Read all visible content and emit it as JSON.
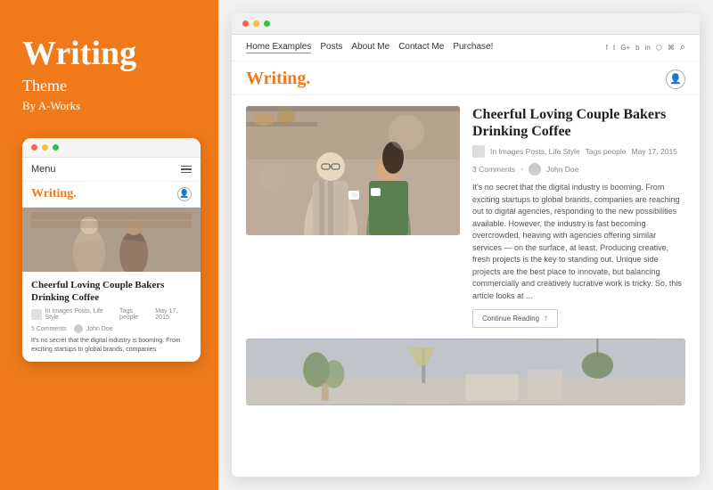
{
  "left": {
    "theme_title": "Writing",
    "theme_word": "Theme",
    "theme_by": "By A-Works",
    "mobile": {
      "nav_menu": "Menu",
      "logo": "Writing",
      "logo_dot": ".",
      "post_title": "Cheerful Loving Couple Bakers Drinking Coffee",
      "meta_category": "In Images Posts, Life Style",
      "meta_tags": "Tags people",
      "meta_date": "May 17, 2015",
      "meta_comments": "5 Comments",
      "meta_author": "John Doe",
      "excerpt": "It's no secret that the digital industry is booming. From exciting startups to global brands, companies"
    }
  },
  "right": {
    "nav_links": [
      "Home Examples",
      "Posts",
      "About Me",
      "Contact Me",
      "Purchase!"
    ],
    "logo": "Writing",
    "logo_dot": ".",
    "featured": {
      "title": "Cheerful Loving Couple Bakers Drinking Coffee",
      "meta_category": "In Images Posts, Life Style",
      "meta_tags": "Tags people",
      "meta_date": "May 17, 2015",
      "meta_comments": "3 Comments",
      "meta_author": "John Doe",
      "excerpt": "It's no secret that the digital industry is booming. From exciting startups to global brands, companies are reaching out to digital agencies, responding to the new possibilities available. However, the industry is fast becoming overcrowded, heaving with agencies offering similar services — on the surface, at least. Producing creative, fresh projects is the key to standing out. Unique side projects are the best place to innovate, but balancing commercially and creatively lucrative work is tricky. So, this article looks at ...",
      "continue_label": "Continue Reading"
    }
  },
  "colors": {
    "orange": "#F07A1A",
    "dark": "#222222",
    "gray": "#888888"
  }
}
